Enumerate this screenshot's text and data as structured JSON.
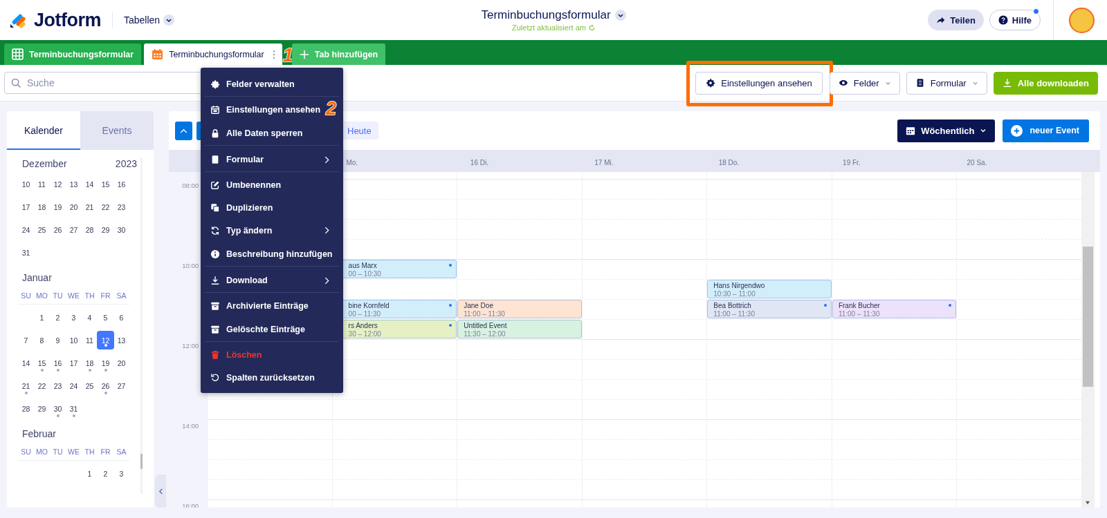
{
  "header": {
    "logo": "Jotform",
    "workspace": "Tabellen",
    "title": "Terminbuchungsformular",
    "subtitle": "Zuletzt aktualisiert am",
    "share": "Teilen",
    "help": "Hilfe",
    "help_notification": true
  },
  "tabs": [
    {
      "label": "Terminbuchungsformular",
      "kind": "table",
      "selected": false
    },
    {
      "label": "Terminbuchungsformular",
      "kind": "calendar",
      "selected": true,
      "marker": "1"
    },
    {
      "label": "Tab hinzufügen",
      "kind": "add",
      "selected": false
    }
  ],
  "search": {
    "placeholder": "Suche"
  },
  "toolbar": [
    {
      "label": "Einstellungen ansehen",
      "kind": "settings",
      "dropdown": false,
      "highlighted": true
    },
    {
      "label": "Felder",
      "kind": "fields",
      "dropdown": true,
      "highlighted": false
    },
    {
      "label": "Formular",
      "kind": "form",
      "dropdown": true,
      "highlighted": false
    },
    {
      "label": "Alle downloaden",
      "kind": "download",
      "dropdown": false,
      "highlighted": false
    }
  ],
  "menu": {
    "items": [
      {
        "label": "Felder verwalten",
        "submenu": false,
        "danger": false,
        "separator_after": true
      },
      {
        "label": "Einstellungen ansehen",
        "submenu": false,
        "danger": false,
        "separator_after": false,
        "marker": "2"
      },
      {
        "label": "Alle Daten sperren",
        "submenu": false,
        "danger": false,
        "separator_after": true
      },
      {
        "label": "Formular",
        "submenu": true,
        "danger": false,
        "separator_after": true
      },
      {
        "label": "Umbenennen",
        "submenu": false,
        "danger": false,
        "separator_after": false
      },
      {
        "label": "Duplizieren",
        "submenu": false,
        "danger": false,
        "separator_after": false
      },
      {
        "label": "Typ ändern",
        "submenu": true,
        "danger": false,
        "separator_after": false
      },
      {
        "label": "Beschreibung hinzufügen",
        "submenu": false,
        "danger": false,
        "separator_after": true
      },
      {
        "label": "Download",
        "submenu": true,
        "danger": false,
        "separator_after": true
      },
      {
        "label": "Archivierte Einträge",
        "submenu": false,
        "danger": false,
        "separator_after": false
      },
      {
        "label": "Gelöschte Einträge",
        "submenu": false,
        "danger": false,
        "separator_after": true
      },
      {
        "label": "Löschen",
        "submenu": false,
        "danger": true,
        "separator_after": false
      },
      {
        "label": "Spalten zurücksetzen",
        "submenu": false,
        "danger": false,
        "separator_after": false
      }
    ]
  },
  "sidebar": {
    "tabs": [
      {
        "label": "Kalender",
        "selected": true
      },
      {
        "label": "Events",
        "selected": false
      }
    ],
    "months": [
      {
        "name": "Dezember",
        "year": "2023",
        "weeks": [
          [
            {
              "day": "10",
              "selected": false,
              "dot": false
            },
            {
              "day": "11",
              "selected": false,
              "dot": false
            },
            {
              "day": "12",
              "selected": false,
              "dot": false
            },
            {
              "day": "13",
              "selected": false,
              "dot": false
            },
            {
              "day": "14",
              "selected": false,
              "dot": false
            },
            {
              "day": "15",
              "selected": false,
              "dot": false
            },
            {
              "day": "16",
              "selected": false,
              "dot": false
            }
          ],
          [
            {
              "day": "17",
              "selected": false,
              "dot": false
            },
            {
              "day": "18",
              "selected": false,
              "dot": false
            },
            {
              "day": "19",
              "selected": false,
              "dot": false
            },
            {
              "day": "20",
              "selected": false,
              "dot": false
            },
            {
              "day": "21",
              "selected": false,
              "dot": false
            },
            {
              "day": "22",
              "selected": false,
              "dot": false
            },
            {
              "day": "23",
              "selected": false,
              "dot": false
            }
          ],
          [
            {
              "day": "24",
              "selected": false,
              "dot": false
            },
            {
              "day": "25",
              "selected": false,
              "dot": false
            },
            {
              "day": "26",
              "selected": false,
              "dot": false
            },
            {
              "day": "27",
              "selected": false,
              "dot": false
            },
            {
              "day": "28",
              "selected": false,
              "dot": false
            },
            {
              "day": "29",
              "selected": false,
              "dot": false
            },
            {
              "day": "30",
              "selected": false,
              "dot": false
            }
          ],
          [
            {
              "day": "31",
              "selected": false,
              "dot": false
            }
          ]
        ]
      },
      {
        "name": "Januar",
        "first_week_partial": true,
        "weekdays": [
          "SU",
          "MO",
          "TU",
          "WE",
          "TH",
          "FR",
          "SA"
        ],
        "weeks": [
          [
            {
              "day": "1",
              "selected": false,
              "dot": false
            },
            {
              "day": "2",
              "selected": false,
              "dot": false
            },
            {
              "day": "3",
              "selected": false,
              "dot": false
            },
            {
              "day": "4",
              "selected": false,
              "dot": false
            },
            {
              "day": "5",
              "selected": false,
              "dot": false
            },
            {
              "day": "6",
              "selected": false,
              "dot": false
            }
          ],
          [
            {
              "day": "7",
              "selected": false,
              "dot": false
            },
            {
              "day": "8",
              "selected": false,
              "dot": false
            },
            {
              "day": "9",
              "selected": false,
              "dot": false
            },
            {
              "day": "10",
              "selected": false,
              "dot": false
            },
            {
              "day": "11",
              "selected": false,
              "dot": false
            },
            {
              "day": "12",
              "selected": true,
              "dot": true
            },
            {
              "day": "13",
              "selected": false,
              "dot": false
            }
          ],
          [
            {
              "day": "14",
              "selected": false,
              "dot": false
            },
            {
              "day": "15",
              "selected": false,
              "dot": true
            },
            {
              "day": "16",
              "selected": false,
              "dot": true
            },
            {
              "day": "17",
              "selected": false,
              "dot": false
            },
            {
              "day": "18",
              "selected": false,
              "dot": true
            },
            {
              "day": "19",
              "selected": false,
              "dot": true
            },
            {
              "day": "20",
              "selected": false,
              "dot": false
            }
          ],
          [
            {
              "day": "21",
              "selected": false,
              "dot": true
            },
            {
              "day": "22",
              "selected": false,
              "dot": false
            },
            {
              "day": "23",
              "selected": false,
              "dot": false
            },
            {
              "day": "24",
              "selected": false,
              "dot": false
            },
            {
              "day": "25",
              "selected": false,
              "dot": false
            },
            {
              "day": "26",
              "selected": false,
              "dot": true
            },
            {
              "day": "27",
              "selected": false,
              "dot": false
            }
          ],
          [
            {
              "day": "28",
              "selected": false,
              "dot": false
            },
            {
              "day": "29",
              "selected": false,
              "dot": false
            },
            {
              "day": "30",
              "selected": false,
              "dot": true
            },
            {
              "day": "31",
              "selected": false,
              "dot": true
            }
          ]
        ]
      },
      {
        "name": "Februar",
        "first_week_partial": true,
        "weekdays": [
          "SU",
          "MO",
          "TU",
          "WE",
          "TH",
          "FR",
          "SA"
        ],
        "weeks": [
          [
            {
              "day": "1",
              "selected": false,
              "dot": false
            },
            {
              "day": "2",
              "selected": false,
              "dot": false
            },
            {
              "day": "3",
              "selected": false,
              "dot": false
            }
          ]
        ]
      }
    ]
  },
  "calendar": {
    "today": "Heute",
    "view": "Wöchentlich",
    "new_event": "neuer Event",
    "times": [
      "08:00",
      "10:00",
      "12:00",
      "14:00",
      "16:00"
    ],
    "days": [
      {
        "label": "Mo.",
        "events": [
          {
            "title": "aus Marx",
            "time": "00 – 10:30",
            "color": "#d2eefb",
            "dot": true
          },
          {
            "title": "bine Kornfeld",
            "time": "00 – 11:30",
            "color": "#d2eefb",
            "dot": true
          },
          {
            "title": "rs Anders",
            "time": "30 – 12:00",
            "color": "#e5f1c4",
            "dot": true
          }
        ]
      },
      {
        "label": "16 Di.",
        "events": [
          {
            "title": "Jane Doe",
            "time": "11:00 – 11:30",
            "color": "#fde4d3",
            "dot": false
          },
          {
            "title": "Untitled Event",
            "time": "11:30 – 12:00",
            "color": "#d8f2e1",
            "dot": false
          }
        ]
      },
      {
        "label": "17 Mi."
      },
      {
        "label": "18 Do.",
        "events": [
          {
            "title": "Hans Nirgendwo",
            "time": "10:30 – 11:00",
            "color": "#d2eefb",
            "dot": false
          },
          {
            "title": "Bea Bottrich",
            "time": "11:00 – 11:30",
            "color": "#dfe6f4",
            "dot": true
          }
        ]
      },
      {
        "label": "19 Fr.",
        "events": [
          {
            "title": "Frank Bucher",
            "time": "11:00 – 11:30",
            "color": "#ece2fb",
            "dot": true
          }
        ]
      },
      {
        "label": "20 Sa."
      }
    ]
  }
}
